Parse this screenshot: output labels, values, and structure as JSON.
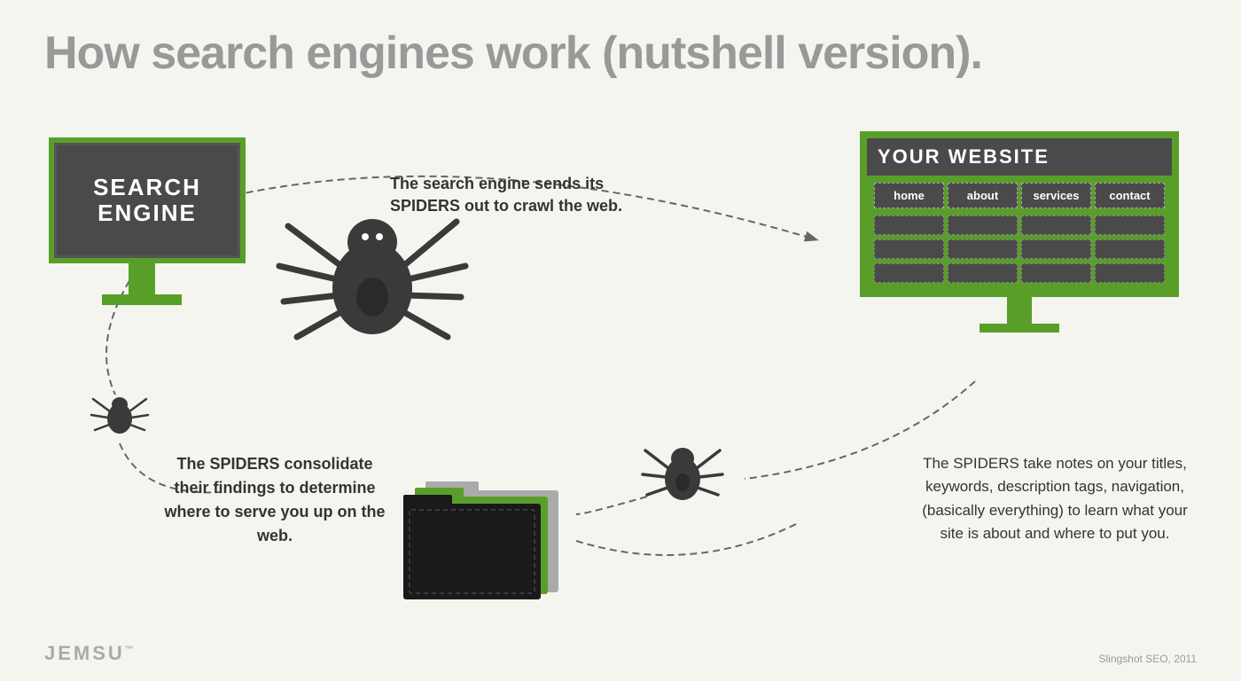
{
  "title": "How search engines work (nutshell version).",
  "search_engine_label": "SEARCH\nENGINE",
  "website_title": "YOUR WEBSITE",
  "nav_items": [
    "home",
    "about",
    "services",
    "contact"
  ],
  "callout_top": "The search engine sends its SPIDERS out to crawl the web.",
  "callout_bottom_left": "The SPIDERS consolidate their findings to determine where to serve you up on the web.",
  "callout_bottom_right": "The SPIDERS take notes on your titles, keywords, description tags, navigation, (basically everything) to learn what your site is about and where to put you.",
  "logo": "JEMSU",
  "attribution": "Slingshot SEO, 2011",
  "colors": {
    "green": "#5a9e2a",
    "dark": "#4a4a4a",
    "bg": "#f5f5f0",
    "text": "#333333",
    "light_text": "#999999"
  }
}
